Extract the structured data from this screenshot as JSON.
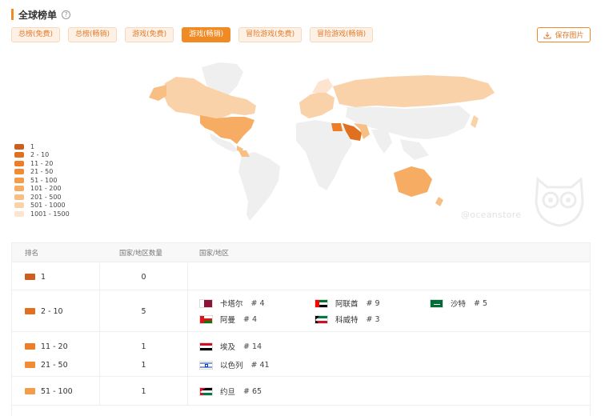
{
  "header": {
    "title": "全球榜单",
    "help_glyph": "?"
  },
  "tabs": [
    {
      "label": "总榜(免费)",
      "active": false
    },
    {
      "label": "总榜(畅销)",
      "active": false
    },
    {
      "label": "游戏(免费)",
      "active": false
    },
    {
      "label": "游戏(畅销)",
      "active": true
    },
    {
      "label": "冒险游戏(免费)",
      "active": false
    },
    {
      "label": "冒险游戏(畅销)",
      "active": false
    }
  ],
  "save_button": {
    "label": "保存图片",
    "icon": "download-icon"
  },
  "watermark": "@oceanstore",
  "colors": {
    "accent": "#f08a24",
    "map_default": "#efefef"
  },
  "legend": [
    {
      "label": "1",
      "color": "#c9601f"
    },
    {
      "label": "2 - 10",
      "color": "#e0701f"
    },
    {
      "label": "11 - 20",
      "color": "#ee7d25"
    },
    {
      "label": "21 - 50",
      "color": "#f28c33"
    },
    {
      "label": "51 - 100",
      "color": "#f49c47"
    },
    {
      "label": "101 - 200",
      "color": "#f6ac62"
    },
    {
      "label": "201 - 500",
      "color": "#f8bf85"
    },
    {
      "label": "501 - 1000",
      "color": "#fad2aa"
    },
    {
      "label": "1001 - 1500",
      "color": "#fce4cf"
    }
  ],
  "table": {
    "headers": {
      "rank": "排名",
      "count": "国家/地区数量",
      "countries": "国家/地区"
    },
    "rows": [
      {
        "rank": "1",
        "color": "#c9601f",
        "count": "0",
        "countries": []
      },
      {
        "rank": "2 - 10",
        "color": "#e0701f",
        "count": "5",
        "countries": [
          {
            "name": "卡塔尔",
            "rank": "# 4",
            "flag": "qatar"
          },
          {
            "name": "阿联酋",
            "rank": "# 9",
            "flag": "uae"
          },
          {
            "name": "沙特",
            "rank": "# 5",
            "flag": "saudi"
          },
          {
            "name": "阿曼",
            "rank": "# 4",
            "flag": "oman"
          },
          {
            "name": "科威特",
            "rank": "# 3",
            "flag": "kuwait"
          }
        ]
      },
      {
        "rank": "11 - 20",
        "color": "#ee7d25",
        "count": "1",
        "countries": [
          {
            "name": "埃及",
            "rank": "# 14",
            "flag": "egypt"
          }
        ]
      },
      {
        "rank": "21 - 50",
        "color": "#f28c33",
        "count": "1",
        "countries": [
          {
            "name": "以色列",
            "rank": "# 41",
            "flag": "israel"
          }
        ]
      },
      {
        "rank": "51 - 100",
        "color": "#f49c47",
        "count": "1",
        "countries": [
          {
            "name": "约旦",
            "rank": "# 65",
            "flag": "jordan"
          }
        ]
      }
    ]
  }
}
